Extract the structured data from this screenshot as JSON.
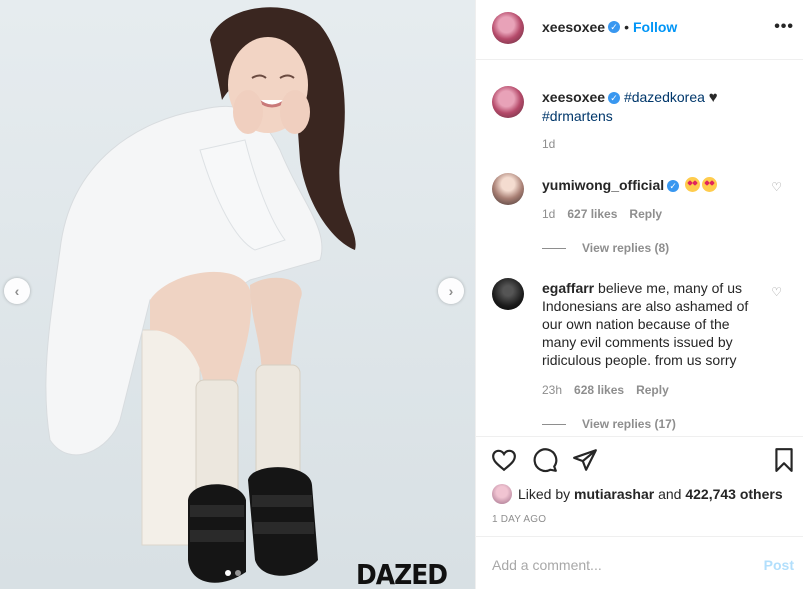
{
  "header": {
    "username": "xeesoxee",
    "separator": "•",
    "follow_label": "Follow",
    "more_label": "•••"
  },
  "photo": {
    "watermark": "DAZED",
    "prev_icon": "chevron-left-icon",
    "next_icon": "chevron-right-icon",
    "slide_count": 2,
    "active_slide": 1
  },
  "caption": {
    "username": "xeesoxee",
    "tag1": "#dazedkorea",
    "tag2": "#drmartens",
    "time": "1d"
  },
  "comments": [
    {
      "username": "yumiwong_official",
      "text": "",
      "time": "1d",
      "likes": "627 likes",
      "reply_label": "Reply",
      "view_replies": "View replies (8)"
    },
    {
      "username": "egaffarr",
      "text": "believe me, many of us Indonesians are also ashamed of our own nation because of the many evil comments issued by ridiculous people. from us sorry",
      "time": "23h",
      "likes": "628 likes",
      "reply_label": "Reply",
      "view_replies": "View replies (17)"
    }
  ],
  "likes_summary": {
    "prefix": "Liked by",
    "user": "mutiarashar",
    "middle": "and",
    "count": "422,743 others"
  },
  "post_age": "1 DAY AGO",
  "add_comment": {
    "placeholder": "Add a comment...",
    "post_label": "Post"
  },
  "colors": {
    "link_blue": "#0095f6",
    "verified_blue": "#3897f0",
    "hashtag": "#00376b",
    "muted": "#8e8e8e",
    "photo_bg": "#dfe6ea"
  }
}
